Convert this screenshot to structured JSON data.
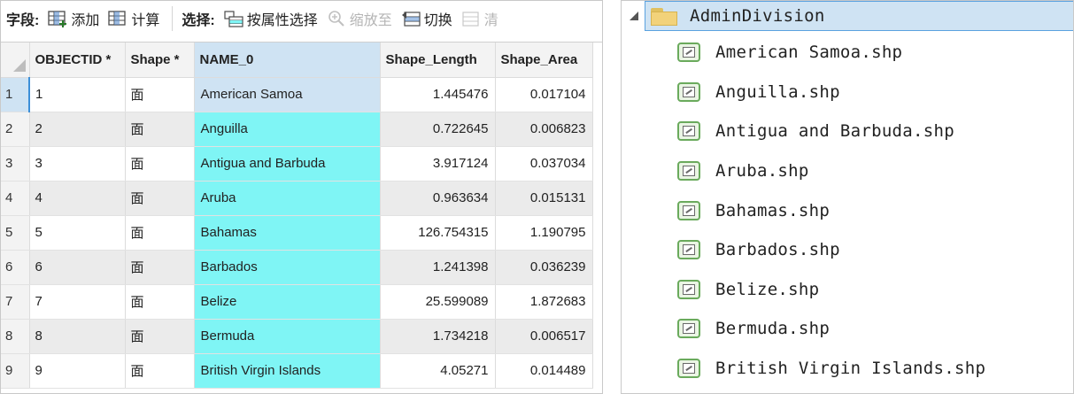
{
  "toolbar": {
    "field_label": "字段:",
    "add_label": "添加",
    "calculate_label": "计算",
    "select_label": "选择:",
    "select_by_attributes_label": "按属性选择",
    "zoom_to_label": "缩放至",
    "switch_label": "切换",
    "clear_label": "清"
  },
  "table": {
    "columns": [
      "OBJECTID *",
      "Shape *",
      "NAME_0",
      "Shape_Length",
      "Shape_Area"
    ],
    "rows": [
      {
        "row": "1",
        "objectid": "1",
        "shape": "面",
        "name": "American Samoa",
        "length": "1.445476",
        "area": "0.017104"
      },
      {
        "row": "2",
        "objectid": "2",
        "shape": "面",
        "name": "Anguilla",
        "length": "0.722645",
        "area": "0.006823"
      },
      {
        "row": "3",
        "objectid": "3",
        "shape": "面",
        "name": "Antigua and Barbuda",
        "length": "3.917124",
        "area": "0.037034"
      },
      {
        "row": "4",
        "objectid": "4",
        "shape": "面",
        "name": "Aruba",
        "length": "0.963634",
        "area": "0.015131"
      },
      {
        "row": "5",
        "objectid": "5",
        "shape": "面",
        "name": "Bahamas",
        "length": "126.754315",
        "area": "1.190795"
      },
      {
        "row": "6",
        "objectid": "6",
        "shape": "面",
        "name": "Barbados",
        "length": "1.241398",
        "area": "0.036239"
      },
      {
        "row": "7",
        "objectid": "7",
        "shape": "面",
        "name": "Belize",
        "length": "25.599089",
        "area": "1.872683"
      },
      {
        "row": "8",
        "objectid": "8",
        "shape": "面",
        "name": "Bermuda",
        "length": "1.734218",
        "area": "0.006517"
      },
      {
        "row": "9",
        "objectid": "9",
        "shape": "面",
        "name": "British Virgin Islands",
        "length": "4.05271",
        "area": "0.014489"
      }
    ]
  },
  "catalog": {
    "folder": "AdminDivision",
    "files": [
      "American Samoa.shp",
      "Anguilla.shp",
      "Antigua and Barbuda.shp",
      "Aruba.shp",
      "Bahamas.shp",
      "Barbados.shp",
      "Belize.shp",
      "Bermuda.shp",
      "British Virgin Islands.shp"
    ]
  },
  "colors": {
    "selected_header": "#cfe3f3",
    "highlight_cyan": "#7ff5f5",
    "shp_icon_green": "#6aaa5c",
    "folder_yellow": "#f2d27a"
  },
  "icons": [
    "add-field-icon",
    "calculate-icon",
    "select-by-attributes-icon",
    "zoom-to-icon",
    "switch-icon",
    "clear-icon",
    "folder-icon",
    "shapefile-icon"
  ]
}
